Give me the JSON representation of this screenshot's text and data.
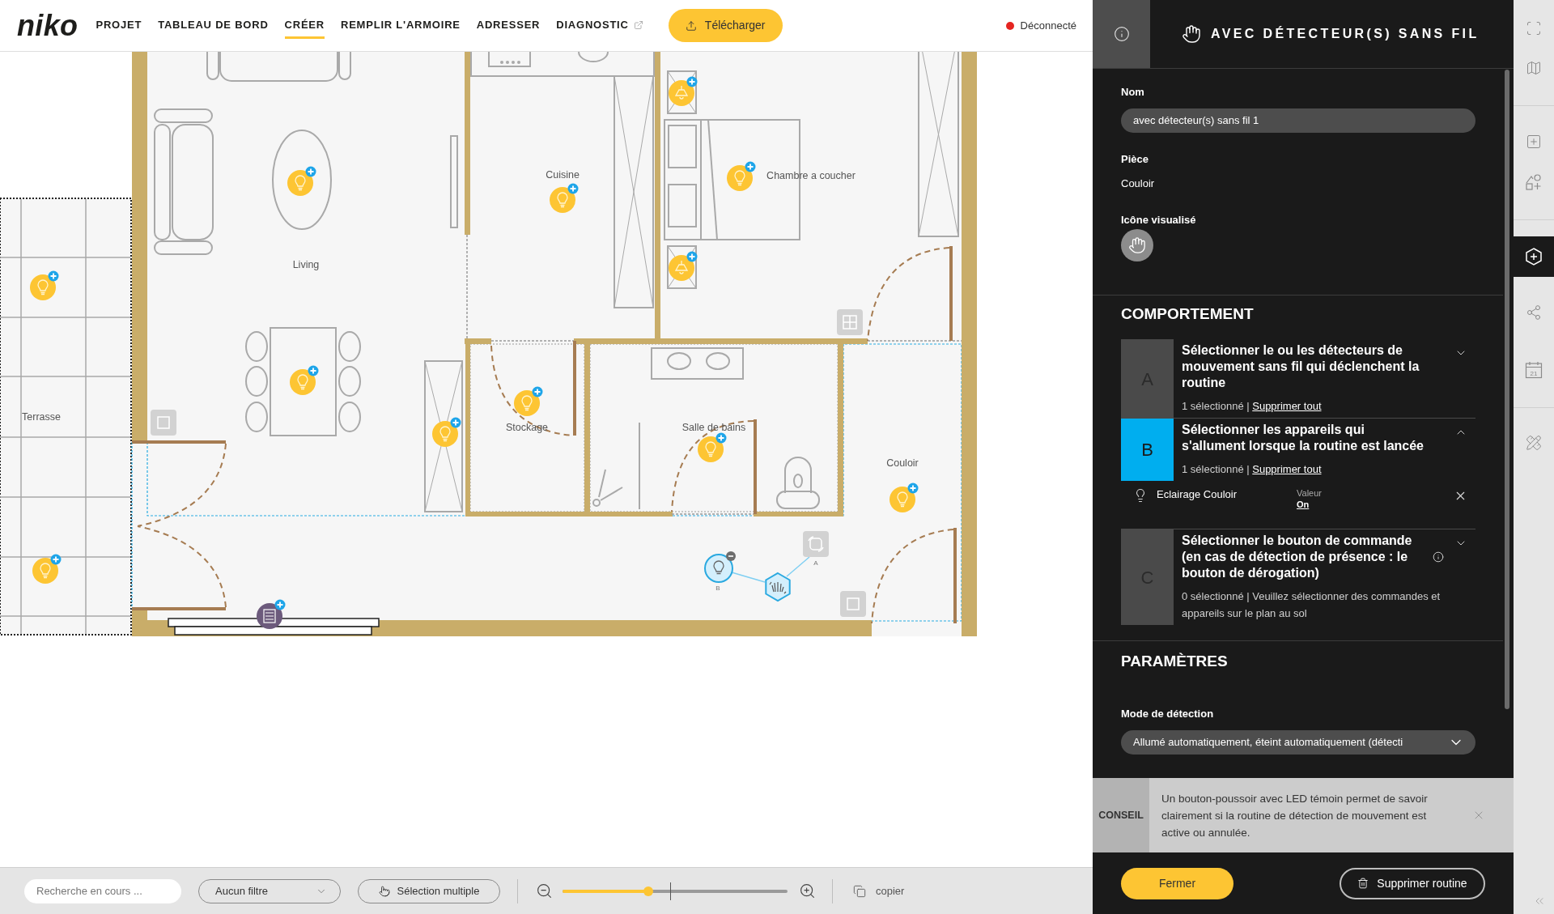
{
  "topbar": {
    "logo": "niko",
    "nav": [
      {
        "label": "PROJET",
        "selected": false,
        "external": false
      },
      {
        "label": "TABLEAU DE BORD",
        "selected": false,
        "external": false
      },
      {
        "label": "CRÉER",
        "selected": true,
        "external": false
      },
      {
        "label": "REMPLIR L'ARMOIRE",
        "selected": false,
        "external": false
      },
      {
        "label": "ADRESSER",
        "selected": false,
        "external": false
      },
      {
        "label": "DIAGNOSTIC",
        "selected": false,
        "external": true
      }
    ],
    "download_button": "Télécharger",
    "status": {
      "label": "Déconnecté",
      "connected": false
    }
  },
  "floor_plan": {
    "rooms": [
      {
        "label": "Cuisine"
      },
      {
        "label": "Chambre a coucher"
      },
      {
        "label": "Living"
      },
      {
        "label": "Terrasse"
      },
      {
        "label": "Stockage"
      },
      {
        "label": "Salle de bains"
      },
      {
        "label": "Couloir"
      }
    ],
    "routine_nodes": [
      {
        "label": "A"
      },
      {
        "label": "B"
      }
    ]
  },
  "bottom_bar": {
    "search": {
      "placeholder": "Recherche en cours ..."
    },
    "filter": {
      "value": "Aucun filtre"
    },
    "multi_select_button": "Sélection multiple",
    "zoom": {
      "level": 0.38
    },
    "copy_button": "copier"
  },
  "panel": {
    "title": "AVEC DÉTECTEUR(S) SANS FIL",
    "name_field": {
      "label": "Nom",
      "value": "avec détecteur(s) sans fil 1"
    },
    "room_field": {
      "label": "Pièce",
      "value": "Couloir"
    },
    "icon_field": {
      "label": "Icône visualisé"
    },
    "behaviour": {
      "heading": "COMPORTEMENT",
      "steps": [
        {
          "letter": "A",
          "title": "Sélectionner le ou les détecteurs de mouvement sans fil qui déclenchent la routine",
          "summary": "1 sélectionné |",
          "action": "Supprimer tout",
          "info": false,
          "selected": false,
          "expanded": false
        },
        {
          "letter": "B",
          "title": "Sélectionner les appareils qui s'allument lorsque la routine est lancée",
          "summary": "1 sélectionné |",
          "action": "Supprimer tout",
          "info": false,
          "selected": true,
          "expanded": true,
          "devices": [
            {
              "name": "Eclairage Couloir",
              "value_label": "Valeur",
              "value": "On"
            }
          ]
        },
        {
          "letter": "C",
          "title": "Sélectionner le bouton de commande (en cas de détection de présence : le bouton de dérogation)",
          "summary": "0 sélectionné | Veuillez sélectionner des commandes et appareils sur le plan au sol",
          "info": true,
          "selected": false,
          "expanded": false
        }
      ]
    },
    "parameters": {
      "heading": "PARAMÈTRES",
      "detection_mode": {
        "label": "Mode de détection",
        "value": "Allumé automatiquement, éteint automatiquement (détecti"
      }
    },
    "tip": {
      "label": "CONSEIL",
      "text": "Un bouton-poussoir avec LED témoin permet de savoir clairement si la routine de détection de mouvement est active ou annulée."
    },
    "close_button": "Fermer",
    "delete_button": "Supprimer routine"
  },
  "tool_rail": {
    "items": [
      {
        "selected": false
      },
      {
        "selected": false
      },
      {
        "selected": false
      },
      {
        "selected": false
      },
      {
        "selected": true
      },
      {
        "selected": false
      },
      {
        "selected": false,
        "label": "21"
      },
      {
        "selected": false
      }
    ]
  }
}
